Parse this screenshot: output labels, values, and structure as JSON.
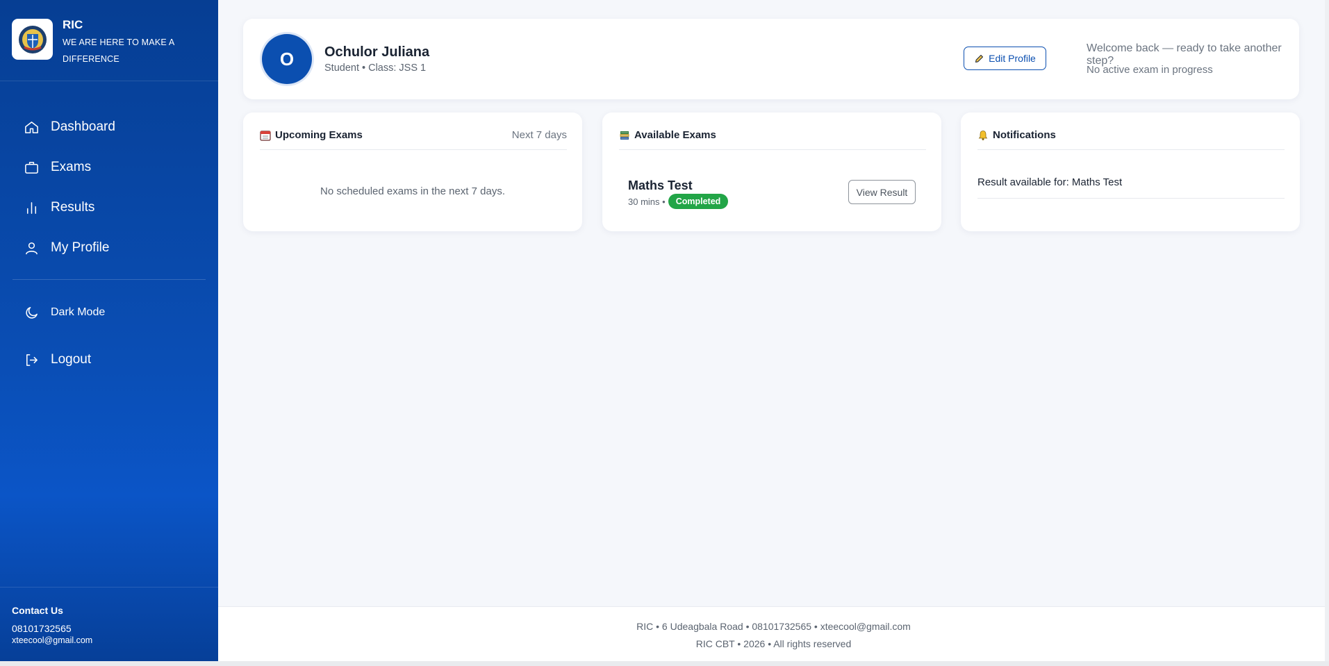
{
  "sidebar": {
    "brand_title": "RIC",
    "brand_sub": "WE ARE HERE TO MAKE A DIFFERENCE",
    "nav": {
      "dashboard": "Dashboard",
      "exams": "Exams",
      "results": "Results",
      "profile": "My Profile",
      "dark_mode": "Dark Mode",
      "logout": "Logout"
    },
    "contact": {
      "title": "Contact Us",
      "phone": "08101732565",
      "email": "xteecool@gmail.com"
    }
  },
  "profile": {
    "initial": "O",
    "name": "Ochulor Juliana",
    "subtitle": "Student • Class: JSS 1",
    "edit_label": "Edit Profile",
    "welcome": "Welcome back — ready to take another step?",
    "status": "No active exam in progress"
  },
  "upcoming": {
    "title": "Upcoming Exams",
    "meta": "Next 7 days",
    "empty": "No scheduled exams in the next 7 days."
  },
  "available": {
    "title": "Available Exams",
    "exam": {
      "title": "Maths Test",
      "duration": "30 mins •",
      "status": "Completed",
      "action": "View Result"
    }
  },
  "notifications": {
    "title": "Notifications",
    "items": [
      "Result available for: Maths Test"
    ]
  },
  "footer": {
    "line1": "RIC • 6 Udeagbala Road • 08101732565 • xteecool@gmail.com",
    "line2": "RIC CBT • 2026 • All rights reserved"
  },
  "colors": {
    "primary": "#0b4fb0",
    "success": "#22a547"
  }
}
